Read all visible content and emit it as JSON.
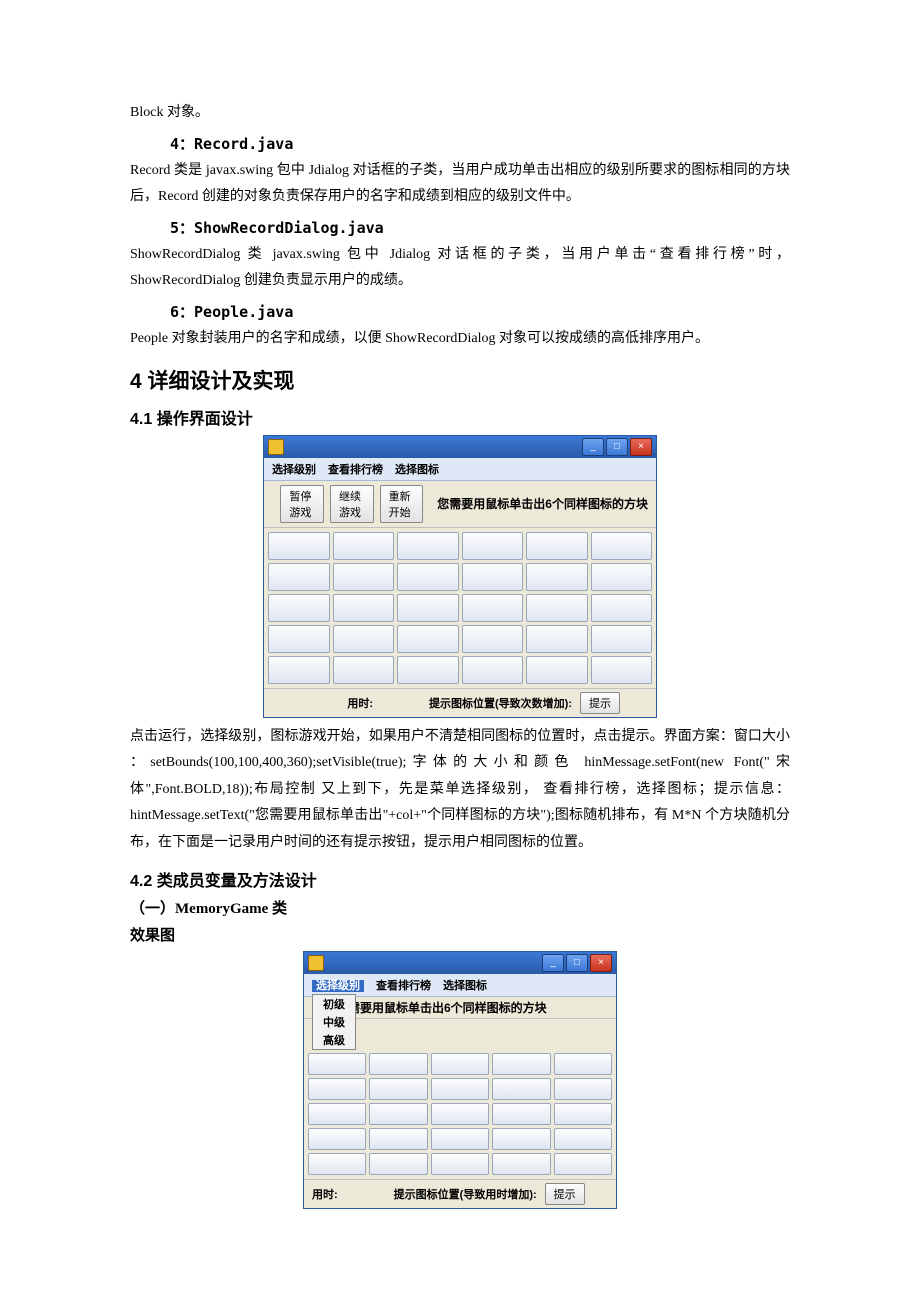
{
  "p_block": "Block 对象。",
  "h_4": "4：Record.java",
  "p_record": "Record 类是 javax.swing 包中 Jdialog 对话框的子类，当用户成功单击出相应的级别所要求的图标相同的方块后，Record 创建的对象负责保存用户的名字和成绩到相应的级别文件中。",
  "h_5": "5：ShowRecordDialog.java",
  "p_show": "ShowRecordDialog 类 javax.swing 包中 Jdialog 对话框的子类，当用户单击“查看排行榜”时，ShowRecordDialog 创建负责显示用户的成绩。",
  "h_6": "6：People.java",
  "p_people": "People 对象封装用户的名字和成绩，以便 ShowRecordDialog 对象可以按成绩的高低排序用户。",
  "h_sec4": "4  详细设计及实现",
  "h_41": "4.1  操作界面设计",
  "p_41": "点击运行，选择级别，图标游戏开始，如果用户不清楚相同图标的位置时，点击提示。界面方案：窗口大小 ：setBounds(100,100,400,360);setVisible(true);字体的大小和颜色 hinMessage.setFont(new Font(\"宋体\",Font.BOLD,18));布局控制  又上到下，先是菜单选择级别，  查看排行榜，选择图标；提示信息：hintMessage.setText(\"您需要用鼠标单击出\"+col+\"个同样图标的方块\");图标随机排布，有 M*N 个方块随机分布，在下面是一记录用户时间的还有提示按钮，提示用户相同图标的位置。",
  "h_42": "4.2  类成员变量及方法设计",
  "h_mg_class": "（一）MemoryGame 类",
  "h_effect": "效果图",
  "win1": {
    "menu": {
      "m1": "选择级别",
      "m2": "查看排行榜",
      "m3": "选择图标"
    },
    "btn_pause": "暂停游戏",
    "btn_continue": "继续游戏",
    "btn_restart": "重新开始",
    "hint_msg": "您需要用鼠标单击出6个同样图标的方块",
    "status_time_label": "用时:",
    "status_hint_label": "提示图标位置(导致次数增加):",
    "btn_hint": "提示"
  },
  "win2": {
    "menu": {
      "m1": "选择级别",
      "m2": "查看排行榜",
      "m3": "选择图标"
    },
    "levels": {
      "l1": "初级",
      "l2": "中级",
      "l3": "高级"
    },
    "hint_msg": "需要用鼠标单击出6个同样图标的方块",
    "status_time_label": "用时:",
    "status_hint_label": "提示图标位置(导致用时增加):",
    "btn_hint": "提示"
  }
}
